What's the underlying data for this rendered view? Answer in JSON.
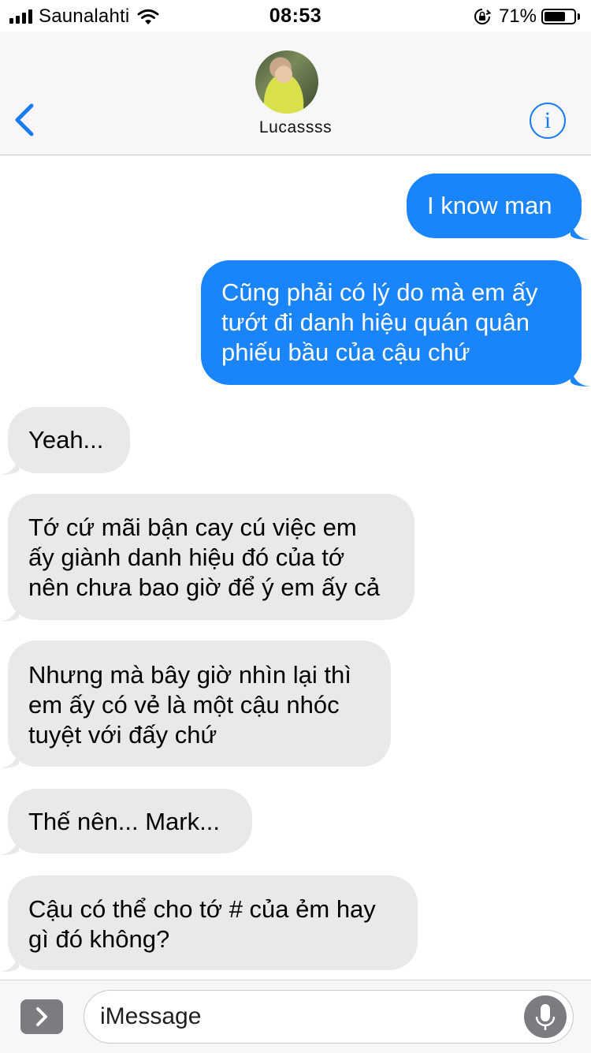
{
  "status_bar": {
    "carrier": "Saunalahti",
    "time": "08:53",
    "battery_percent_text": "71%",
    "battery_level": 0.71,
    "icons": [
      "signal-icon",
      "wifi-icon",
      "rotation-lock-icon",
      "battery-icon"
    ]
  },
  "header": {
    "contact_name": "Lucassss",
    "back_icon": "chevron-left-icon",
    "info_icon_glyph": "i"
  },
  "messages": [
    {
      "direction": "outgoing",
      "text": "I know man"
    },
    {
      "direction": "outgoing",
      "text": "Cũng phải có lý do mà em ấy\ntướt đi danh hiệu quán quân\nphiếu bầu của cậu chứ"
    },
    {
      "direction": "incoming",
      "text": "Yeah..."
    },
    {
      "direction": "incoming",
      "text": "Tớ cứ mãi bận cay cú việc em\nấy giành danh hiệu đó của tớ\nnên chưa bao giờ để ý em ấy cả"
    },
    {
      "direction": "incoming",
      "text": "Nhưng mà bây giờ nhìn lại thì\nem ấy có vẻ là một cậu nhóc\ntuyệt với đấy chứ"
    },
    {
      "direction": "incoming",
      "text": "Thế nên... Mark..."
    },
    {
      "direction": "incoming",
      "text": "Cậu có thể cho tớ # của ẻm hay\ngì đó không?"
    }
  ],
  "input_bar": {
    "placeholder": "iMessage",
    "expand_icon": "chevron-right-icon",
    "mic_icon": "microphone-icon"
  },
  "colors": {
    "outgoing_bubble": "#1a84fb",
    "incoming_bubble": "#e9e9eb",
    "accent": "#1a7cf4",
    "header_bg": "#f7f7f7"
  }
}
